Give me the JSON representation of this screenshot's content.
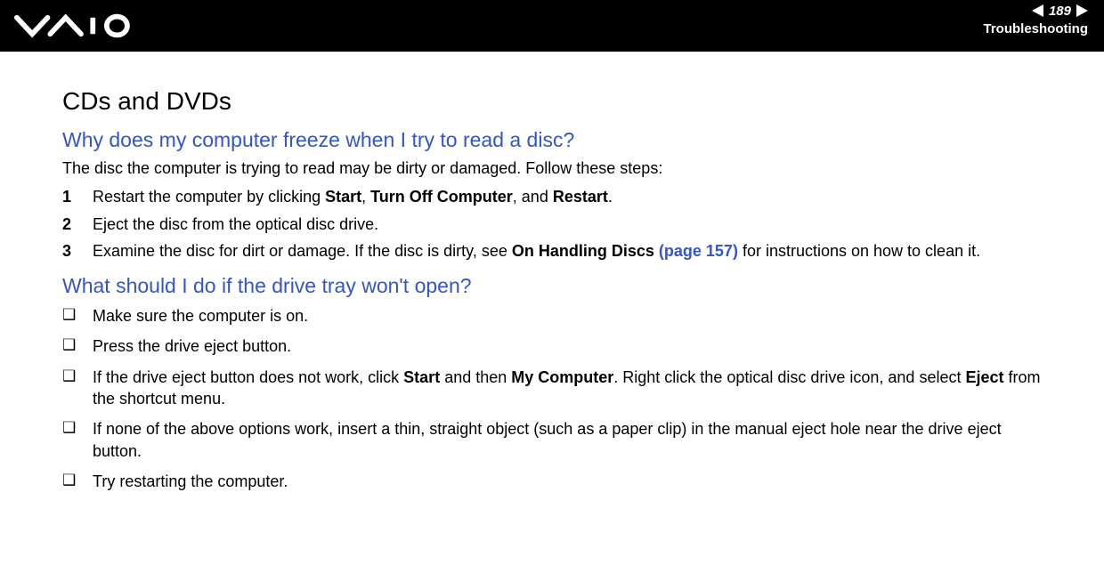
{
  "header": {
    "page_number": "189",
    "section": "Troubleshooting"
  },
  "main": {
    "title": "CDs and DVDs",
    "q1": {
      "question": "Why does my computer freeze when I try to read a disc?",
      "intro": "The disc the computer is trying to read may be dirty or damaged. Follow these steps:",
      "steps": {
        "s1": {
          "pre": "Restart the computer by clicking ",
          "b1": "Start",
          "mid1": ", ",
          "b2": "Turn Off Computer",
          "mid2": ", and ",
          "b3": "Restart",
          "post": "."
        },
        "s2": "Eject the disc from the optical disc drive.",
        "s3": {
          "pre": "Examine the disc for dirt or damage. If the disc is dirty, see ",
          "b1": "On Handling Discs ",
          "link": "(page 157)",
          "post": " for instructions on how to clean it."
        }
      }
    },
    "q2": {
      "question": "What should I do if the drive tray won't open?",
      "bullets": {
        "b1": "Make sure the computer is on.",
        "b2": "Press the drive eject button.",
        "b3": {
          "pre": "If the drive eject button does not work, click ",
          "b1": "Start",
          "mid1": " and then ",
          "b2": "My Computer",
          "mid2": ". Right click the optical disc drive icon, and select ",
          "b3": "Eject",
          "post": " from the shortcut menu."
        },
        "b4": "If none of the above options work, insert a thin, straight object (such as a paper clip) in the manual eject hole near the drive eject button.",
        "b5": "Try restarting the computer."
      }
    }
  }
}
